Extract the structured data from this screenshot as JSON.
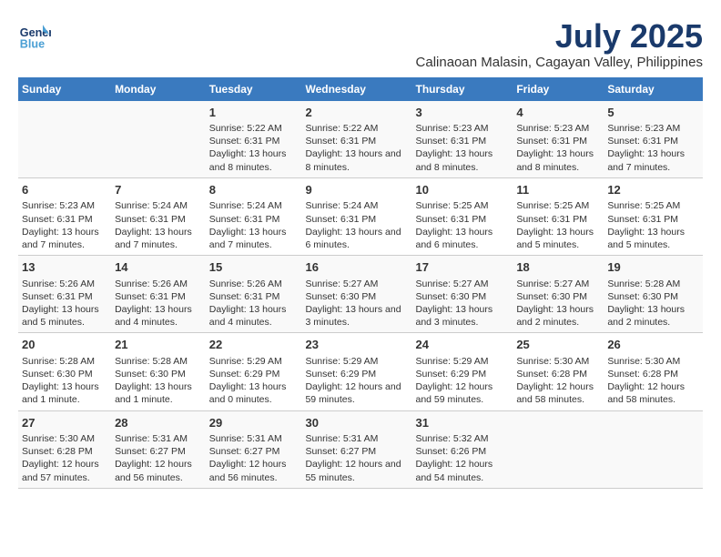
{
  "logo": {
    "line1": "General",
    "line2": "Blue"
  },
  "title": "July 2025",
  "subtitle": "Calinaoan Malasin, Cagayan Valley, Philippines",
  "headers": [
    "Sunday",
    "Monday",
    "Tuesday",
    "Wednesday",
    "Thursday",
    "Friday",
    "Saturday"
  ],
  "weeks": [
    [
      {
        "num": "",
        "detail": ""
      },
      {
        "num": "",
        "detail": ""
      },
      {
        "num": "1",
        "detail": "Sunrise: 5:22 AM\nSunset: 6:31 PM\nDaylight: 13 hours and 8 minutes."
      },
      {
        "num": "2",
        "detail": "Sunrise: 5:22 AM\nSunset: 6:31 PM\nDaylight: 13 hours and 8 minutes."
      },
      {
        "num": "3",
        "detail": "Sunrise: 5:23 AM\nSunset: 6:31 PM\nDaylight: 13 hours and 8 minutes."
      },
      {
        "num": "4",
        "detail": "Sunrise: 5:23 AM\nSunset: 6:31 PM\nDaylight: 13 hours and 8 minutes."
      },
      {
        "num": "5",
        "detail": "Sunrise: 5:23 AM\nSunset: 6:31 PM\nDaylight: 13 hours and 7 minutes."
      }
    ],
    [
      {
        "num": "6",
        "detail": "Sunrise: 5:23 AM\nSunset: 6:31 PM\nDaylight: 13 hours and 7 minutes."
      },
      {
        "num": "7",
        "detail": "Sunrise: 5:24 AM\nSunset: 6:31 PM\nDaylight: 13 hours and 7 minutes."
      },
      {
        "num": "8",
        "detail": "Sunrise: 5:24 AM\nSunset: 6:31 PM\nDaylight: 13 hours and 7 minutes."
      },
      {
        "num": "9",
        "detail": "Sunrise: 5:24 AM\nSunset: 6:31 PM\nDaylight: 13 hours and 6 minutes."
      },
      {
        "num": "10",
        "detail": "Sunrise: 5:25 AM\nSunset: 6:31 PM\nDaylight: 13 hours and 6 minutes."
      },
      {
        "num": "11",
        "detail": "Sunrise: 5:25 AM\nSunset: 6:31 PM\nDaylight: 13 hours and 5 minutes."
      },
      {
        "num": "12",
        "detail": "Sunrise: 5:25 AM\nSunset: 6:31 PM\nDaylight: 13 hours and 5 minutes."
      }
    ],
    [
      {
        "num": "13",
        "detail": "Sunrise: 5:26 AM\nSunset: 6:31 PM\nDaylight: 13 hours and 5 minutes."
      },
      {
        "num": "14",
        "detail": "Sunrise: 5:26 AM\nSunset: 6:31 PM\nDaylight: 13 hours and 4 minutes."
      },
      {
        "num": "15",
        "detail": "Sunrise: 5:26 AM\nSunset: 6:31 PM\nDaylight: 13 hours and 4 minutes."
      },
      {
        "num": "16",
        "detail": "Sunrise: 5:27 AM\nSunset: 6:30 PM\nDaylight: 13 hours and 3 minutes."
      },
      {
        "num": "17",
        "detail": "Sunrise: 5:27 AM\nSunset: 6:30 PM\nDaylight: 13 hours and 3 minutes."
      },
      {
        "num": "18",
        "detail": "Sunrise: 5:27 AM\nSunset: 6:30 PM\nDaylight: 13 hours and 2 minutes."
      },
      {
        "num": "19",
        "detail": "Sunrise: 5:28 AM\nSunset: 6:30 PM\nDaylight: 13 hours and 2 minutes."
      }
    ],
    [
      {
        "num": "20",
        "detail": "Sunrise: 5:28 AM\nSunset: 6:30 PM\nDaylight: 13 hours and 1 minute."
      },
      {
        "num": "21",
        "detail": "Sunrise: 5:28 AM\nSunset: 6:30 PM\nDaylight: 13 hours and 1 minute."
      },
      {
        "num": "22",
        "detail": "Sunrise: 5:29 AM\nSunset: 6:29 PM\nDaylight: 13 hours and 0 minutes."
      },
      {
        "num": "23",
        "detail": "Sunrise: 5:29 AM\nSunset: 6:29 PM\nDaylight: 12 hours and 59 minutes."
      },
      {
        "num": "24",
        "detail": "Sunrise: 5:29 AM\nSunset: 6:29 PM\nDaylight: 12 hours and 59 minutes."
      },
      {
        "num": "25",
        "detail": "Sunrise: 5:30 AM\nSunset: 6:28 PM\nDaylight: 12 hours and 58 minutes."
      },
      {
        "num": "26",
        "detail": "Sunrise: 5:30 AM\nSunset: 6:28 PM\nDaylight: 12 hours and 58 minutes."
      }
    ],
    [
      {
        "num": "27",
        "detail": "Sunrise: 5:30 AM\nSunset: 6:28 PM\nDaylight: 12 hours and 57 minutes."
      },
      {
        "num": "28",
        "detail": "Sunrise: 5:31 AM\nSunset: 6:27 PM\nDaylight: 12 hours and 56 minutes."
      },
      {
        "num": "29",
        "detail": "Sunrise: 5:31 AM\nSunset: 6:27 PM\nDaylight: 12 hours and 56 minutes."
      },
      {
        "num": "30",
        "detail": "Sunrise: 5:31 AM\nSunset: 6:27 PM\nDaylight: 12 hours and 55 minutes."
      },
      {
        "num": "31",
        "detail": "Sunrise: 5:32 AM\nSunset: 6:26 PM\nDaylight: 12 hours and 54 minutes."
      },
      {
        "num": "",
        "detail": ""
      },
      {
        "num": "",
        "detail": ""
      }
    ]
  ]
}
